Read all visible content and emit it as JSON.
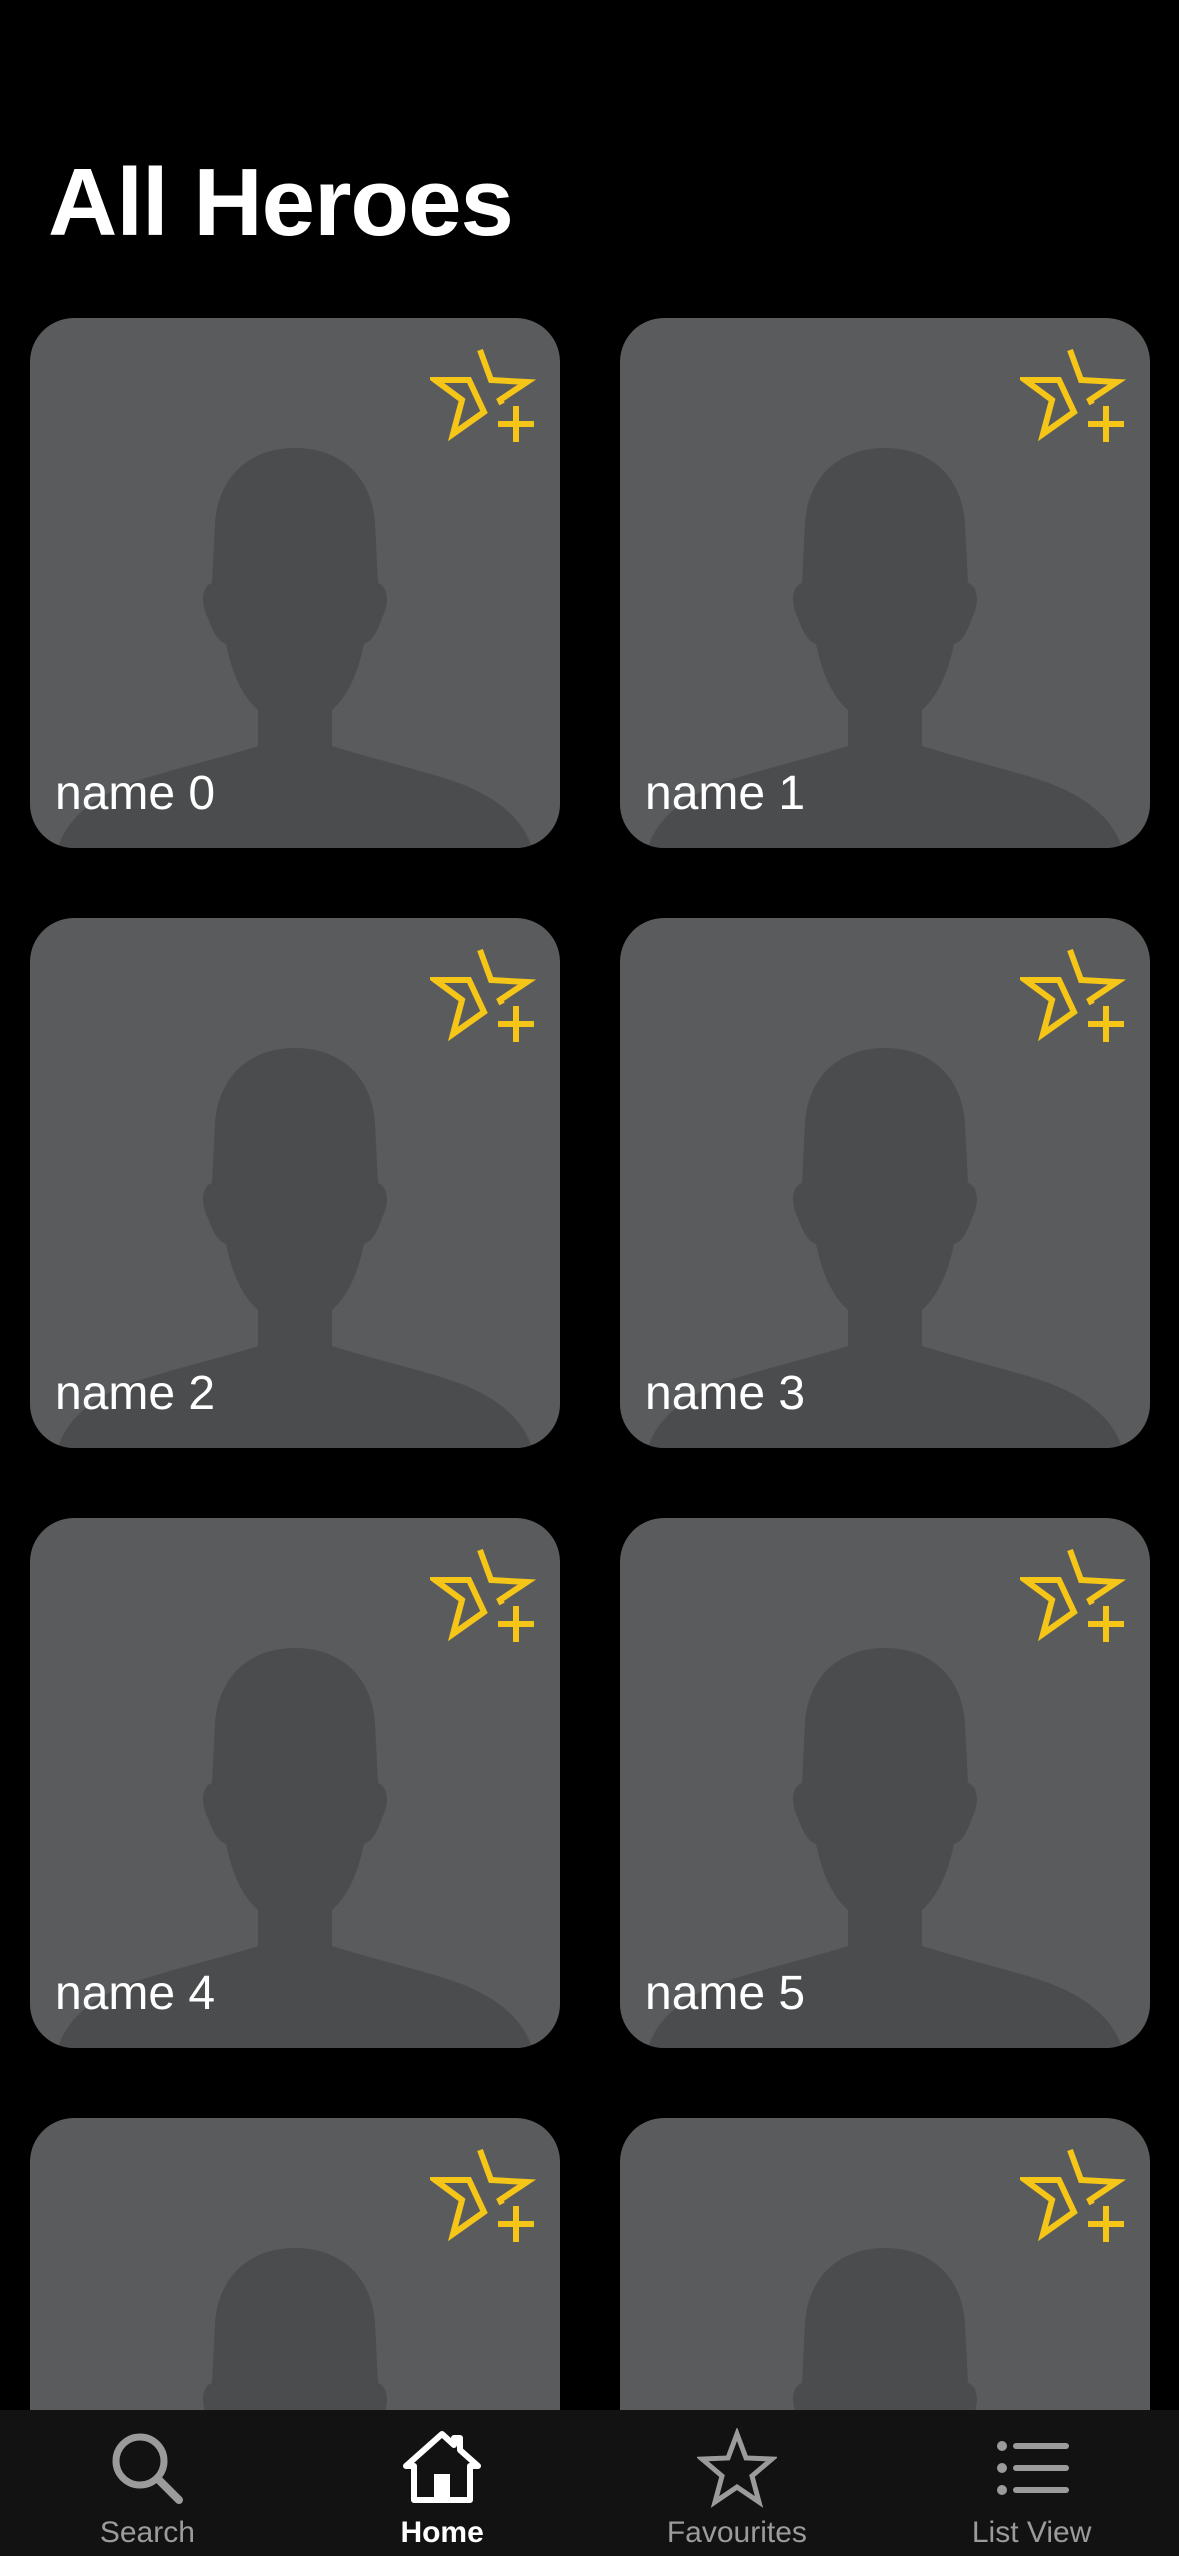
{
  "header": {
    "title": "All Heroes"
  },
  "colors": {
    "background": "#000000",
    "card": "#5a5b5c",
    "silhouette": "#4b4c4d",
    "favourite_accent": "#f5c518",
    "tab_active": "#ffffff",
    "tab_inactive": "#9b9b9b"
  },
  "heroes": [
    {
      "name": "name 0",
      "favourite_icon": "star-plus-icon"
    },
    {
      "name": "name 1",
      "favourite_icon": "star-plus-icon"
    },
    {
      "name": "name 2",
      "favourite_icon": "star-plus-icon"
    },
    {
      "name": "name 3",
      "favourite_icon": "star-plus-icon"
    },
    {
      "name": "name 4",
      "favourite_icon": "star-plus-icon"
    },
    {
      "name": "name 5",
      "favourite_icon": "star-plus-icon"
    },
    {
      "name": "",
      "favourite_icon": "star-plus-icon"
    },
    {
      "name": "",
      "favourite_icon": "star-plus-icon"
    }
  ],
  "tabbar": {
    "tabs": [
      {
        "label": "Search",
        "icon": "search-icon",
        "active": false
      },
      {
        "label": "Home",
        "icon": "home-icon",
        "active": true
      },
      {
        "label": "Favourites",
        "icon": "star-icon",
        "active": false
      },
      {
        "label": "List View",
        "icon": "list-icon",
        "active": false
      }
    ]
  }
}
